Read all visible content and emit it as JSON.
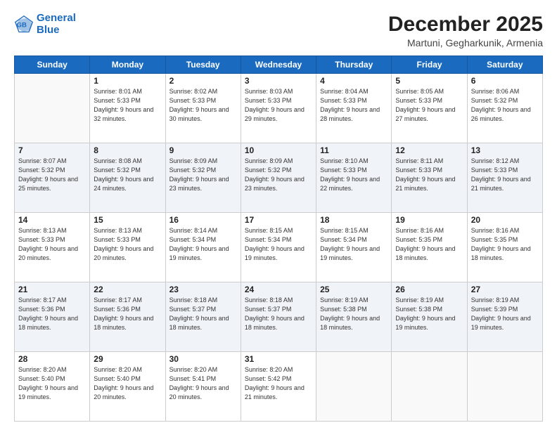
{
  "header": {
    "logo_line1": "General",
    "logo_line2": "Blue",
    "title": "December 2025",
    "subtitle": "Martuni, Gegharkunik, Armenia"
  },
  "calendar": {
    "days_of_week": [
      "Sunday",
      "Monday",
      "Tuesday",
      "Wednesday",
      "Thursday",
      "Friday",
      "Saturday"
    ],
    "weeks": [
      [
        {
          "day": "",
          "empty": true
        },
        {
          "day": "1",
          "sunrise": "8:01 AM",
          "sunset": "5:33 PM",
          "daylight": "9 hours and 32 minutes."
        },
        {
          "day": "2",
          "sunrise": "8:02 AM",
          "sunset": "5:33 PM",
          "daylight": "9 hours and 30 minutes."
        },
        {
          "day": "3",
          "sunrise": "8:03 AM",
          "sunset": "5:33 PM",
          "daylight": "9 hours and 29 minutes."
        },
        {
          "day": "4",
          "sunrise": "8:04 AM",
          "sunset": "5:33 PM",
          "daylight": "9 hours and 28 minutes."
        },
        {
          "day": "5",
          "sunrise": "8:05 AM",
          "sunset": "5:33 PM",
          "daylight": "9 hours and 27 minutes."
        },
        {
          "day": "6",
          "sunrise": "8:06 AM",
          "sunset": "5:32 PM",
          "daylight": "9 hours and 26 minutes."
        }
      ],
      [
        {
          "day": "7",
          "sunrise": "8:07 AM",
          "sunset": "5:32 PM",
          "daylight": "9 hours and 25 minutes."
        },
        {
          "day": "8",
          "sunrise": "8:08 AM",
          "sunset": "5:32 PM",
          "daylight": "9 hours and 24 minutes."
        },
        {
          "day": "9",
          "sunrise": "8:09 AM",
          "sunset": "5:32 PM",
          "daylight": "9 hours and 23 minutes."
        },
        {
          "day": "10",
          "sunrise": "8:09 AM",
          "sunset": "5:32 PM",
          "daylight": "9 hours and 23 minutes."
        },
        {
          "day": "11",
          "sunrise": "8:10 AM",
          "sunset": "5:33 PM",
          "daylight": "9 hours and 22 minutes."
        },
        {
          "day": "12",
          "sunrise": "8:11 AM",
          "sunset": "5:33 PM",
          "daylight": "9 hours and 21 minutes."
        },
        {
          "day": "13",
          "sunrise": "8:12 AM",
          "sunset": "5:33 PM",
          "daylight": "9 hours and 21 minutes."
        }
      ],
      [
        {
          "day": "14",
          "sunrise": "8:13 AM",
          "sunset": "5:33 PM",
          "daylight": "9 hours and 20 minutes."
        },
        {
          "day": "15",
          "sunrise": "8:13 AM",
          "sunset": "5:33 PM",
          "daylight": "9 hours and 20 minutes."
        },
        {
          "day": "16",
          "sunrise": "8:14 AM",
          "sunset": "5:34 PM",
          "daylight": "9 hours and 19 minutes."
        },
        {
          "day": "17",
          "sunrise": "8:15 AM",
          "sunset": "5:34 PM",
          "daylight": "9 hours and 19 minutes."
        },
        {
          "day": "18",
          "sunrise": "8:15 AM",
          "sunset": "5:34 PM",
          "daylight": "9 hours and 19 minutes."
        },
        {
          "day": "19",
          "sunrise": "8:16 AM",
          "sunset": "5:35 PM",
          "daylight": "9 hours and 18 minutes."
        },
        {
          "day": "20",
          "sunrise": "8:16 AM",
          "sunset": "5:35 PM",
          "daylight": "9 hours and 18 minutes."
        }
      ],
      [
        {
          "day": "21",
          "sunrise": "8:17 AM",
          "sunset": "5:36 PM",
          "daylight": "9 hours and 18 minutes."
        },
        {
          "day": "22",
          "sunrise": "8:17 AM",
          "sunset": "5:36 PM",
          "daylight": "9 hours and 18 minutes."
        },
        {
          "day": "23",
          "sunrise": "8:18 AM",
          "sunset": "5:37 PM",
          "daylight": "9 hours and 18 minutes."
        },
        {
          "day": "24",
          "sunrise": "8:18 AM",
          "sunset": "5:37 PM",
          "daylight": "9 hours and 18 minutes."
        },
        {
          "day": "25",
          "sunrise": "8:19 AM",
          "sunset": "5:38 PM",
          "daylight": "9 hours and 18 minutes."
        },
        {
          "day": "26",
          "sunrise": "8:19 AM",
          "sunset": "5:38 PM",
          "daylight": "9 hours and 19 minutes."
        },
        {
          "day": "27",
          "sunrise": "8:19 AM",
          "sunset": "5:39 PM",
          "daylight": "9 hours and 19 minutes."
        }
      ],
      [
        {
          "day": "28",
          "sunrise": "8:20 AM",
          "sunset": "5:40 PM",
          "daylight": "9 hours and 19 minutes."
        },
        {
          "day": "29",
          "sunrise": "8:20 AM",
          "sunset": "5:40 PM",
          "daylight": "9 hours and 20 minutes."
        },
        {
          "day": "30",
          "sunrise": "8:20 AM",
          "sunset": "5:41 PM",
          "daylight": "9 hours and 20 minutes."
        },
        {
          "day": "31",
          "sunrise": "8:20 AM",
          "sunset": "5:42 PM",
          "daylight": "9 hours and 21 minutes."
        },
        {
          "day": "",
          "empty": true
        },
        {
          "day": "",
          "empty": true
        },
        {
          "day": "",
          "empty": true
        }
      ]
    ]
  }
}
